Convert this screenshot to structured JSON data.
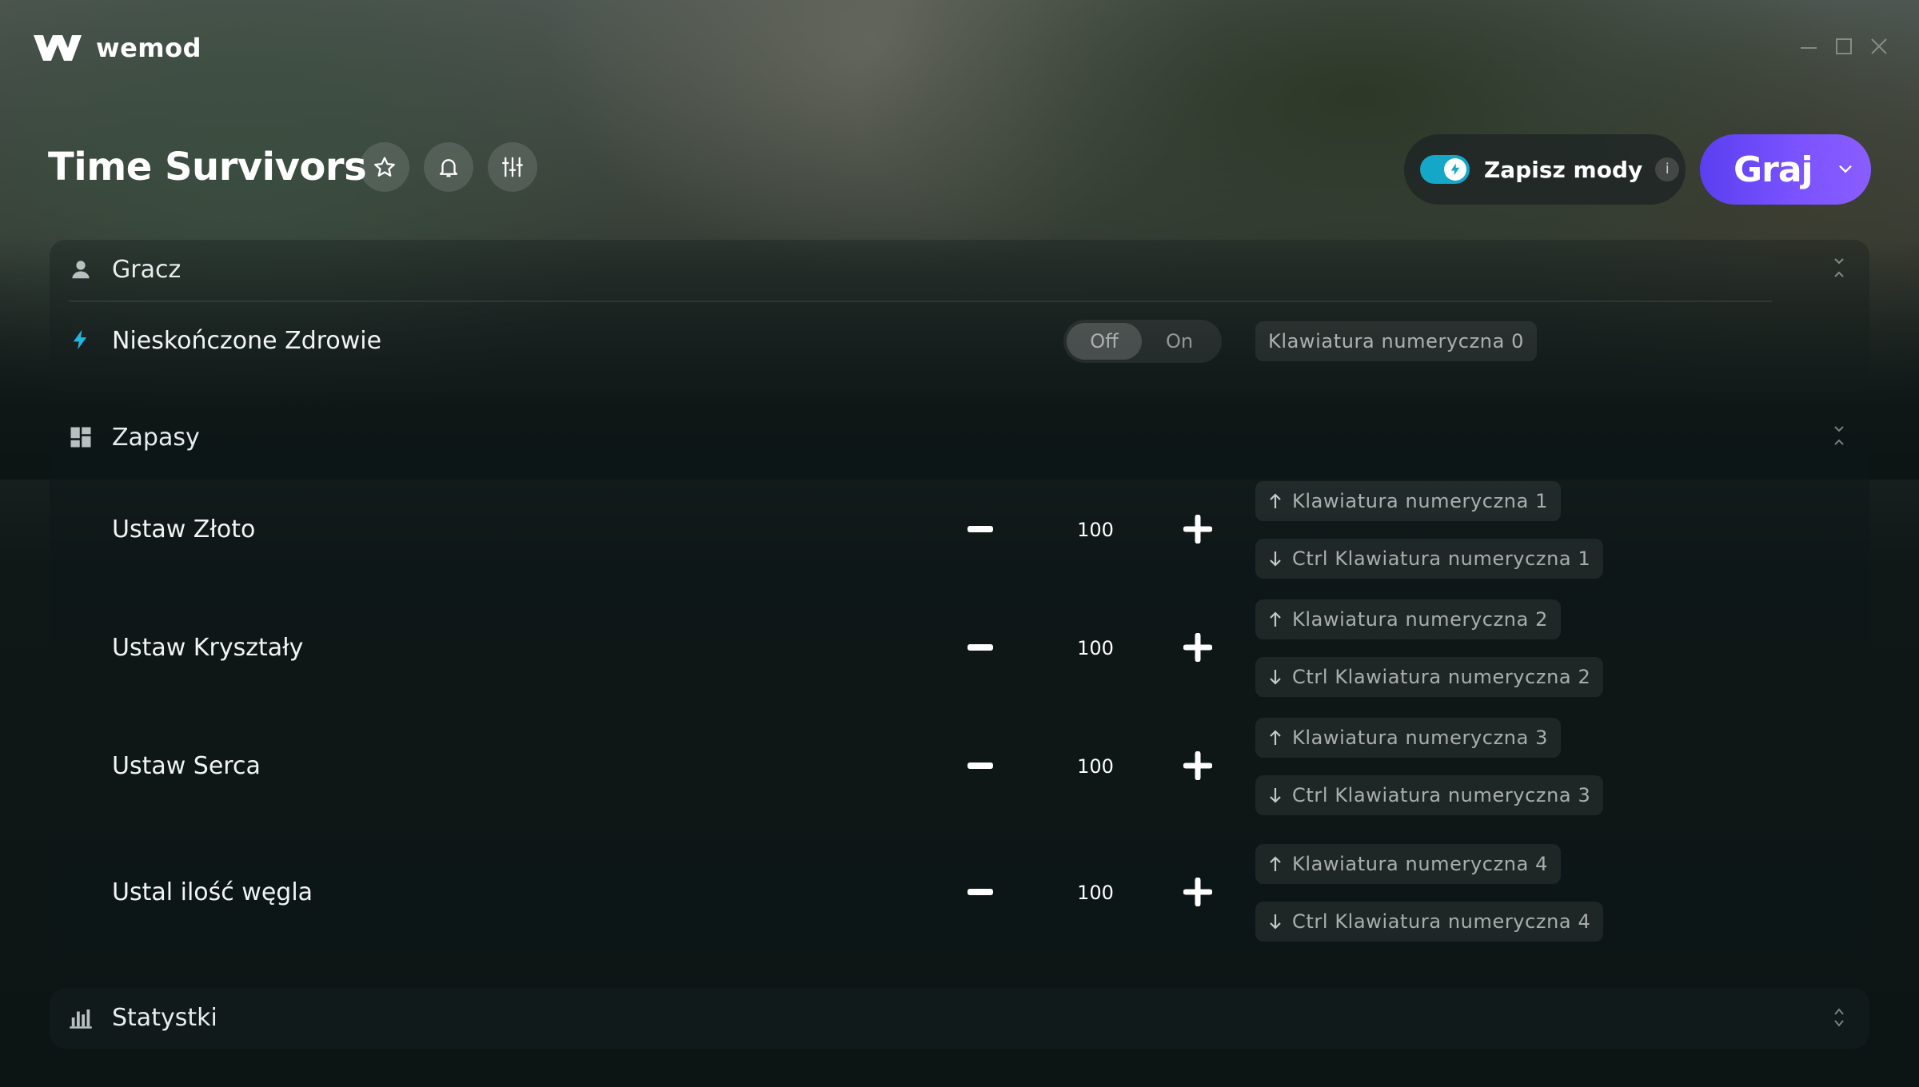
{
  "app": {
    "name": "wemod",
    "window_controls": [
      "minimize",
      "maximize",
      "close"
    ]
  },
  "header": {
    "game_title": "Time Survivors",
    "icons": [
      "star-icon",
      "bell-icon",
      "sliders-icon"
    ],
    "save_mods": {
      "label": "Zapisz mody",
      "enabled": true,
      "info": "i"
    },
    "play": {
      "label": "Graj"
    }
  },
  "sections": {
    "player": {
      "label": "Gracz",
      "cheats": [
        {
          "label": "Nieskończone Zdrowie",
          "toggle_off": "Off",
          "toggle_on": "On",
          "state": "Off",
          "hotkey": "Klawiatura numeryczna 0"
        }
      ]
    },
    "inventory": {
      "label": "Zapasy",
      "cheats": [
        {
          "label": "Ustaw Złoto",
          "value": "100",
          "hotkey_up": "Klawiatura numeryczna 1",
          "hotkey_down": "Ctrl Klawiatura numeryczna 1"
        },
        {
          "label": "Ustaw Kryształy",
          "value": "100",
          "hotkey_up": "Klawiatura numeryczna 2",
          "hotkey_down": "Ctrl Klawiatura numeryczna 2"
        },
        {
          "label": "Ustaw Serca",
          "value": "100",
          "hotkey_up": "Klawiatura numeryczna 3",
          "hotkey_down": "Ctrl Klawiatura numeryczna 3"
        },
        {
          "label": "Ustal ilość węgla",
          "value": "100",
          "hotkey_up": "Klawiatura numeryczna 4",
          "hotkey_down": "Ctrl Klawiatura numeryczna 4"
        }
      ]
    },
    "stats": {
      "label": "Statystki"
    }
  },
  "colors": {
    "accent_toggle": "#14a7c8",
    "play_button": "#6b4bff",
    "bolt": "#1fb6e0"
  }
}
